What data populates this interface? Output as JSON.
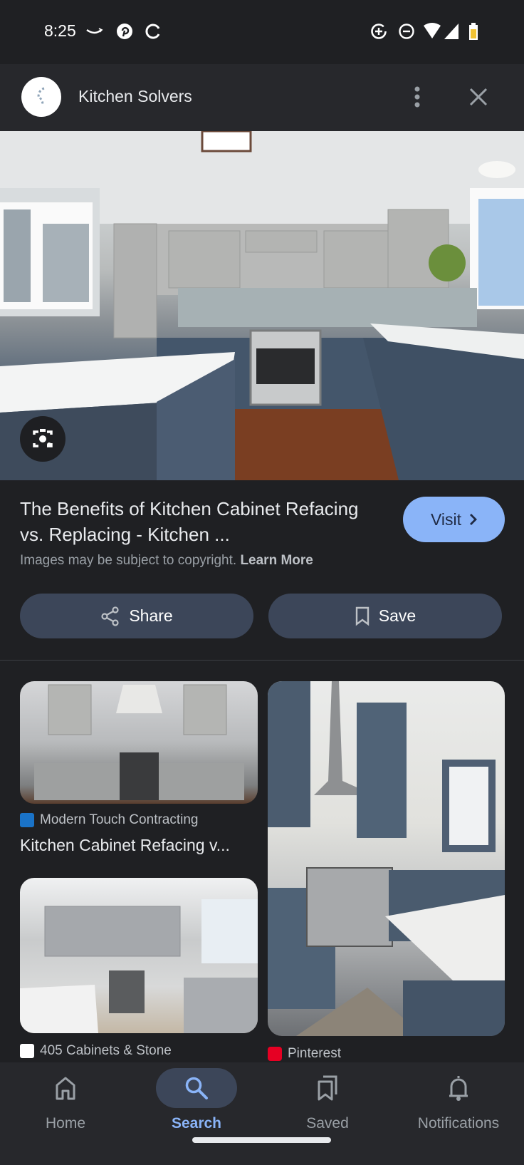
{
  "status_bar": {
    "time": "8:25",
    "left_icons": [
      "amazon-icon",
      "pinterest-icon",
      "sync-icon"
    ],
    "right_icons": [
      "data-saver-icon",
      "do-not-disturb-icon",
      "wifi-icon",
      "signal-icon",
      "battery-charging-icon"
    ]
  },
  "header": {
    "site_name": "Kitchen Solvers",
    "more_icon": "more-vert-icon",
    "close_icon": "close-icon"
  },
  "result": {
    "title": "The Benefits of Kitchen Cabinet Refacing vs. Replacing - Kitchen ...",
    "copyright_text": "Images may be subject to copyright.",
    "learn_more": "Learn More",
    "visit_label": "Visit",
    "share_label": "Share",
    "save_label": "Save"
  },
  "related": [
    {
      "source": "Modern Touch Contracting",
      "caption": "Kitchen Cabinet Refacing v...",
      "favicon_color": "#1a73c8"
    },
    {
      "source": "405 Cabinets & Stone",
      "caption": "",
      "favicon_color": "#ffffff"
    },
    {
      "source": "Pinterest",
      "caption": "",
      "favicon_color": "#e60023"
    }
  ],
  "bottom_nav": {
    "items": [
      {
        "label": "Home",
        "icon": "home-icon",
        "active": false
      },
      {
        "label": "Search",
        "icon": "search-icon",
        "active": true
      },
      {
        "label": "Saved",
        "icon": "collections-bookmark-icon",
        "active": false
      },
      {
        "label": "Notifications",
        "icon": "bell-icon",
        "active": false
      }
    ]
  },
  "colors": {
    "accent": "#8ab4f8",
    "button_bg": "#3c4659",
    "background": "#1f2023"
  }
}
